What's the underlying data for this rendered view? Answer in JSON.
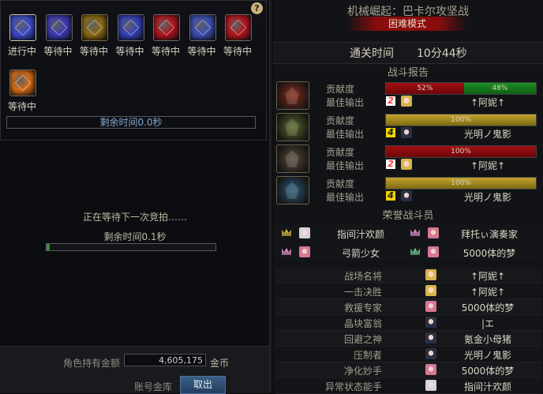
{
  "loot": [
    {
      "label": "进行中",
      "color": "#3a48c8",
      "border": "#cfc39a"
    },
    {
      "label": "等待中",
      "color": "#3b38b4",
      "border": "#6b6860"
    },
    {
      "label": "等待中",
      "color": "#8a6a12",
      "border": "#7a6a40"
    },
    {
      "label": "等待中",
      "color": "#3440b8",
      "border": "#6b6860"
    },
    {
      "label": "等待中",
      "color": "#b0141c",
      "border": "#6b6860"
    },
    {
      "label": "等待中",
      "color": "#3a4eb4",
      "border": "#6b6860"
    },
    {
      "label": "等待中",
      "color": "#b4141c",
      "border": "#6b6860"
    },
    {
      "label": "等待中",
      "color": "#d86a14",
      "border": "#6b6860"
    }
  ],
  "help_icon": "?",
  "timer_text": "剩余时间0.0秒",
  "waiting_text": "正在等待下一次竞拍……",
  "bid_remaining": "剩余时间0.1秒",
  "bid_progress": 0.02,
  "gold_label": "角色持有金额",
  "gold_value": "4,605,175",
  "gold_unit": "金币",
  "bank_label": "账号金库",
  "logout_label": "取出",
  "title": "机械崛起：巴卡尔攻坚战",
  "mode": "困难模式",
  "clear_time_label": "通关时间",
  "clear_time_value": "10分44秒",
  "battle_report_title": "战斗报告",
  "report": [
    {
      "contribution_label": "贡献度",
      "output_label": "最佳输出",
      "segments": [
        {
          "pct": 52,
          "text": "52%",
          "kind": "red"
        },
        {
          "pct": 48,
          "text": "48%",
          "kind": "green"
        }
      ],
      "rank": "2",
      "rank_kind": "rank2",
      "avatar": "av-blonde",
      "name": "↑阿妮↑",
      "boss_color": "#8a2a1a"
    },
    {
      "contribution_label": "贡献度",
      "output_label": "最佳输出",
      "segments": [
        {
          "pct": 100,
          "text": "100%",
          "kind": "gold"
        }
      ],
      "rank": "4",
      "rank_kind": "rank4",
      "avatar": "av-dark",
      "name": "光明ノ鬼影",
      "boss_color": "#5b6a2a"
    },
    {
      "contribution_label": "贡献度",
      "output_label": "最佳输出",
      "segments": [
        {
          "pct": 100,
          "text": "100%",
          "kind": "red"
        }
      ],
      "rank": "2",
      "rank_kind": "rank2",
      "avatar": "av-blonde",
      "name": "↑阿妮↑",
      "boss_color": "#5a4a3a"
    },
    {
      "contribution_label": "贡献度",
      "output_label": "最佳输出",
      "segments": [
        {
          "pct": 100,
          "text": "100%",
          "kind": "gold"
        }
      ],
      "rank": "4",
      "rank_kind": "rank4",
      "avatar": "av-dark",
      "name": "光明ノ鬼影",
      "boss_color": "#2a5a7a"
    }
  ],
  "honor_title": "荣誉战斗员",
  "honor": [
    [
      {
        "crown": "gold",
        "avatar": "av-white",
        "name": "指间汁欢颜"
      },
      {
        "crown": "pink",
        "avatar": "av-pink",
        "name": "拜托ぃ演奏家"
      }
    ],
    [
      {
        "crown": "pink",
        "avatar": "av-pink",
        "name": "弓箭少女"
      },
      {
        "crown": "green",
        "avatar": "av-pink",
        "name": "5000体的梦"
      }
    ]
  ],
  "stats": [
    {
      "label": "战场名将",
      "avatar": "av-blonde",
      "name": "↑阿妮↑"
    },
    {
      "label": "一击决胜",
      "avatar": "av-blonde",
      "name": "↑阿妮↑"
    },
    {
      "label": "救援专家",
      "avatar": "av-pink",
      "name": "5000体的梦"
    },
    {
      "label": "晶块富翁",
      "avatar": "av-dark",
      "name": "|エ"
    },
    {
      "label": "回避之神",
      "avatar": "av-dark",
      "name": "氪金小母猪"
    },
    {
      "label": "压制者",
      "avatar": "av-dark",
      "name": "光明ノ鬼影"
    },
    {
      "label": "净化妙手",
      "avatar": "av-pink",
      "name": "5000体的梦"
    },
    {
      "label": "异常状态能手",
      "avatar": "av-white",
      "name": "指间汁欢颜"
    }
  ]
}
